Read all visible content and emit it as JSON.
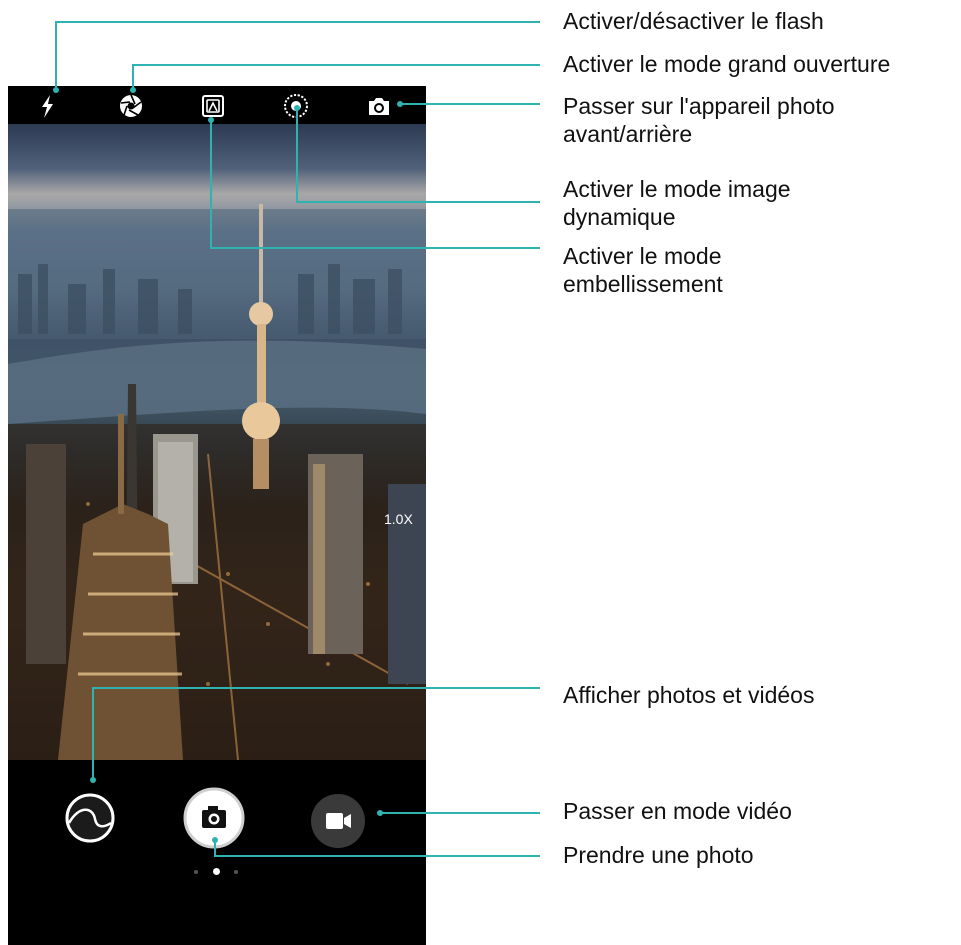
{
  "colors": {
    "leader_line": "#2fb3b0",
    "phone_bg": "#000000",
    "callout_text": "#111111"
  },
  "top_bar": {
    "icons": [
      "flash-icon",
      "aperture-icon",
      "beauty-mode-icon",
      "moving-picture-icon",
      "switch-camera-icon"
    ]
  },
  "viewfinder": {
    "zoom_level": "1.0X"
  },
  "bottom_bar": {
    "gallery_icon": "gallery-thumbnail-icon",
    "shutter_icon": "camera-icon",
    "video_icon": "video-camera-icon",
    "page_dots": 3,
    "active_dot": 2
  },
  "callouts": {
    "flash": "Activer/désactiver le flash",
    "aperture": "Activer le mode grand ouverture",
    "switch_camera": "Passer sur l'appareil photo\navant/arrière",
    "moving_picture": "Activer le mode image\ndynamique",
    "beauty": "Activer le mode\nembellissement",
    "gallery": "Afficher photos et vidéos",
    "video": "Passer en mode vidéo",
    "take_photo": "Prendre une photo"
  }
}
